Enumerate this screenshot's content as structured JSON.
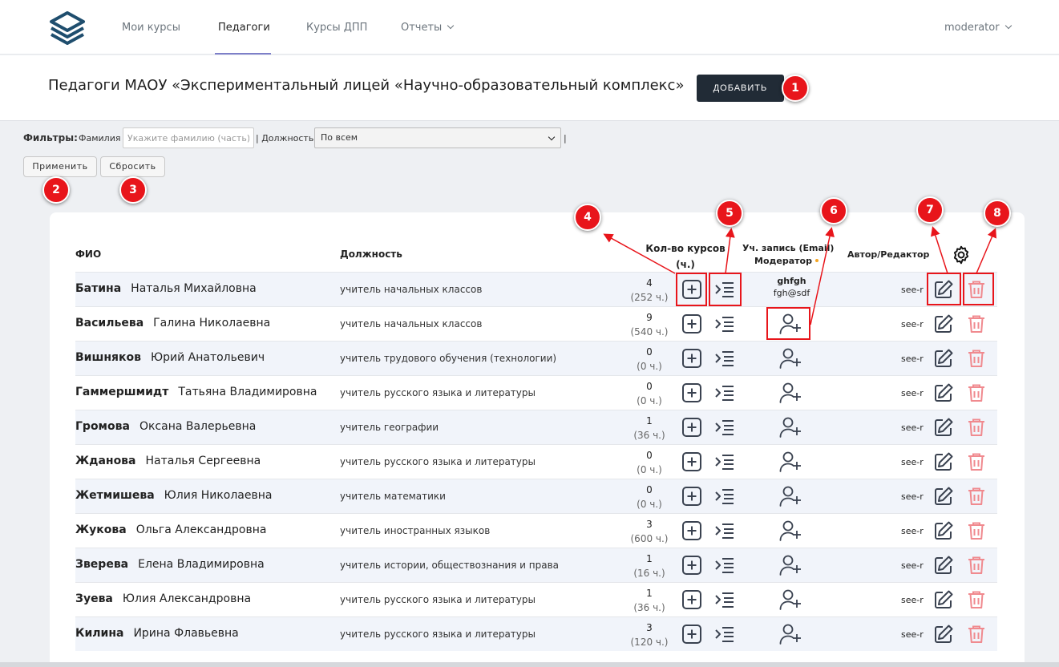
{
  "nav": {
    "items": [
      {
        "label": "Мои курсы",
        "active": false
      },
      {
        "label": "Педагоги",
        "active": true
      },
      {
        "label": "Курсы ДПП",
        "active": false
      },
      {
        "label": "Отчеты",
        "active": false
      }
    ],
    "user": "moderator"
  },
  "header": {
    "title": "Педагоги МАОУ «Экспериментальный лицей «Научно-образовательный комплекс»",
    "add_label": "ДОБАВИТЬ"
  },
  "filters": {
    "label": "Фильтры:",
    "surname_label": "Фамилия",
    "surname_placeholder": "Укажите фамилию (часть)...",
    "separator": "|",
    "position_label": "| Должность",
    "position_value": "По всем",
    "apply_label": "Применить",
    "reset_label": "Сбросить"
  },
  "badges": [
    "1",
    "2",
    "3",
    "4",
    "5",
    "6",
    "7",
    "8"
  ],
  "table": {
    "headers": {
      "fio": "ФИО",
      "position": "Должность",
      "courses_line1": "Кол-во курсов",
      "courses_line2": "(ч.)",
      "account_line1": "Уч. запись (Email)",
      "account_line2": "Модератор",
      "author": "Автор/Редактор"
    },
    "rows": [
      {
        "last": "Батина",
        "first": "Наталья Михайловна",
        "position": "учитель начальных классов",
        "count": "4",
        "hours": "(252 ч.)",
        "account_name": "ghfgh",
        "account_email": "fgh@sdf",
        "author": "see-r"
      },
      {
        "last": "Васильева",
        "first": "Галина Николаевна",
        "position": "учитель начальных классов",
        "count": "9",
        "hours": "(540 ч.)",
        "author": "see-r"
      },
      {
        "last": "Вишняков",
        "first": "Юрий Анатольевич",
        "position": "учитель трудового обучения (технологии)",
        "count": "0",
        "hours": "(0 ч.)",
        "author": "see-r"
      },
      {
        "last": "Гаммершмидт",
        "first": "Татьяна Владимировна",
        "position": "учитель русского языка и литературы",
        "count": "0",
        "hours": "(0 ч.)",
        "author": "see-r"
      },
      {
        "last": "Громова",
        "first": "Оксана Валерьевна",
        "position": "учитель географии",
        "count": "1",
        "hours": "(36 ч.)",
        "author": "see-r"
      },
      {
        "last": "Жданова",
        "first": "Наталья Сергеевна",
        "position": "учитель русского языка и литературы",
        "count": "0",
        "hours": "(0 ч.)",
        "author": "see-r"
      },
      {
        "last": "Жетмишева",
        "first": "Юлия Николаевна",
        "position": "учитель математики",
        "count": "0",
        "hours": "(0 ч.)",
        "author": "see-r"
      },
      {
        "last": "Жукова",
        "first": "Ольга Александровна",
        "position": "учитель иностранных языков",
        "count": "3",
        "hours": "(600 ч.)",
        "author": "see-r"
      },
      {
        "last": "Зверева",
        "first": "Елена Владимировна",
        "position": "учитель истории, обществознания и права",
        "count": "1",
        "hours": "(16 ч.)",
        "author": "see-r"
      },
      {
        "last": "Зуева",
        "first": "Юлия Александровна",
        "position": "учитель русского языка и литературы",
        "count": "1",
        "hours": "(36 ч.)",
        "author": "see-r"
      },
      {
        "last": "Килина",
        "first": "Ирина Флавьевна",
        "position": "учитель русского языка и литературы",
        "count": "3",
        "hours": "(120 ч.)",
        "author": "see-r"
      }
    ]
  },
  "colors": {
    "accent": "#e8151b",
    "dark_button": "#212b36",
    "delete": "#f08a8f",
    "icon": "#3a4250"
  }
}
